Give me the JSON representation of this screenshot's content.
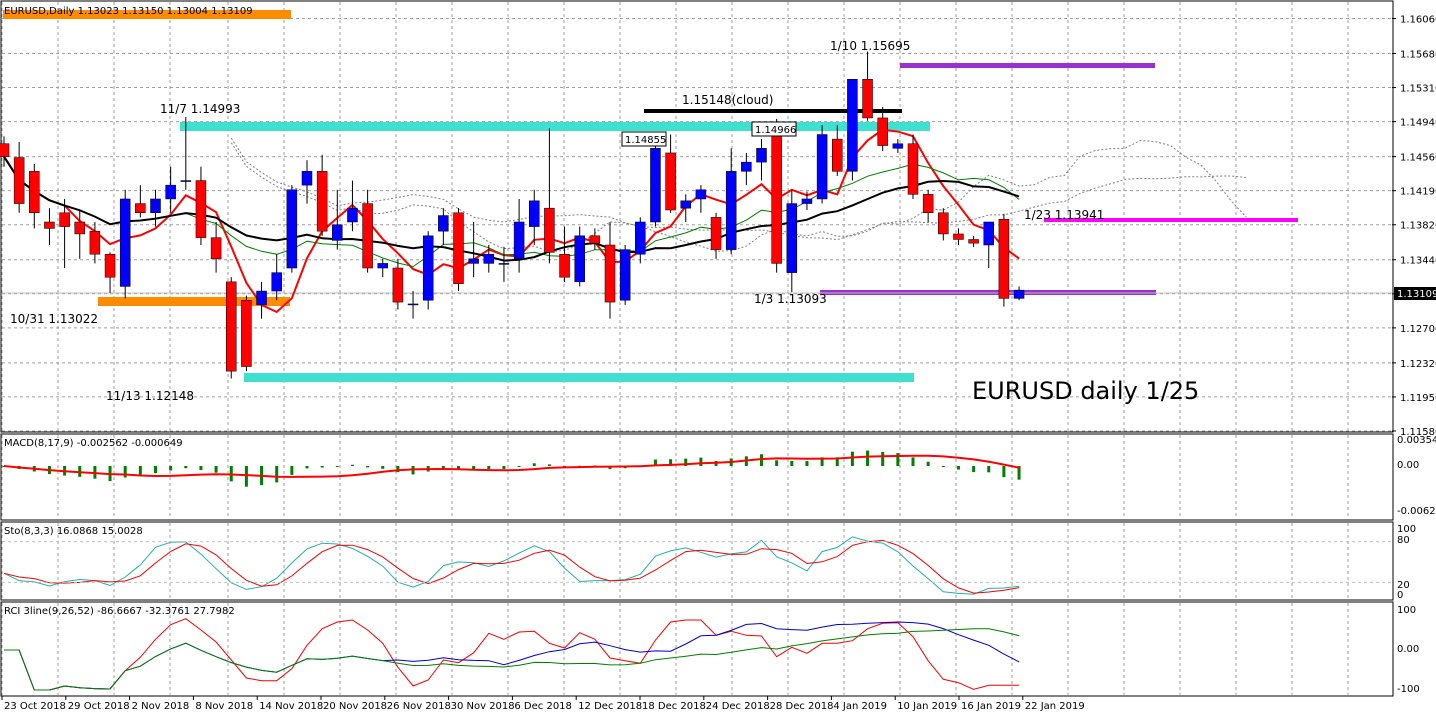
{
  "main": {
    "header": "EURUSD,Daily  1.13023 1.13150 1.13004 1.13109",
    "big_label": "EURUSD daily 1/25",
    "price_axis": [
      "1.16060",
      "1.15680",
      "1.15310",
      "1.14940",
      "1.14560",
      "1.14190",
      "1.13820",
      "1.13440",
      "1.13070",
      "1.12700",
      "1.12320",
      "1.11950",
      "1.11580"
    ],
    "current_price": "1.13109",
    "annotations": {
      "a1": "11/7 1.14993",
      "a2": "10/31 1.13022",
      "a3": "11/13 1.12148",
      "a4": "1.15148(cloud)",
      "a5": "1.14855",
      "a6": "1.14966",
      "a7": "1/10 1.15695",
      "a8": "1/3 1.13093",
      "a9": "1/23 1.13941"
    }
  },
  "macd": {
    "header": "MACD(8,17,9) -0.002562 -0.000649",
    "axis": [
      "0.003546",
      "0.00",
      "-0.006237"
    ]
  },
  "sto": {
    "header": "Sto(8,3,3) 16.0868 15.0028",
    "axis": [
      "100",
      "80",
      "20",
      "0"
    ]
  },
  "rci": {
    "header": "RCI 3line(9,26,52) -86.6667 -32.3761 27.7982",
    "axis": [
      "100",
      "0.00",
      "-100"
    ]
  },
  "date_axis": [
    "23 Oct 2018",
    "29 Oct 2018",
    "2 Nov 2018",
    "8 Nov 2018",
    "14 Nov 2018",
    "20 Nov 2018",
    "26 Nov 2018",
    "30 Nov 2018",
    "6 Dec 2018",
    "12 Dec 2018",
    "18 Dec 2018",
    "24 Dec 2018",
    "28 Dec 2018",
    "4 Jan 2019",
    "10 Jan 2019",
    "16 Jan 2019",
    "22 Jan 2019"
  ],
  "colors": {
    "bull": "#0000ff",
    "bear": "#ff0000",
    "orange": "#ff8c00",
    "cyan": "#40e0d0",
    "purple": "#9932cc",
    "magenta": "#ff00ff",
    "macd_hist": "#008000",
    "signal": "#ff0000",
    "ma_black": "#000000",
    "ma_green": "#008000",
    "ma_red": "#ff0000"
  },
  "chart_data": {
    "type": "candlestick",
    "symbol": "EURUSD",
    "timeframe": "Daily",
    "ylim": [
      1.1158,
      1.1625
    ],
    "candles": [
      [
        1.147,
        1.1478,
        1.1445,
        1.1456
      ],
      [
        1.1455,
        1.1472,
        1.1395,
        1.1405
      ],
      [
        1.144,
        1.1448,
        1.1378,
        1.1395
      ],
      [
        1.1385,
        1.14,
        1.136,
        1.1378
      ],
      [
        1.1395,
        1.141,
        1.1335,
        1.138
      ],
      [
        1.1385,
        1.1398,
        1.1345,
        1.1372
      ],
      [
        1.1375,
        1.1385,
        1.134,
        1.135
      ],
      [
        1.135,
        1.1352,
        1.1308,
        1.1325
      ],
      [
        1.1315,
        1.142,
        1.1302,
        1.141
      ],
      [
        1.1405,
        1.1425,
        1.139,
        1.1395
      ],
      [
        1.1395,
        1.142,
        1.138,
        1.141
      ],
      [
        1.141,
        1.1445,
        1.1395,
        1.1425
      ],
      [
        1.143,
        1.1499,
        1.142,
        1.143
      ],
      [
        1.143,
        1.1445,
        1.136,
        1.1368
      ],
      [
        1.1368,
        1.1385,
        1.133,
        1.1345
      ],
      [
        1.132,
        1.1325,
        1.1215,
        1.1223
      ],
      [
        1.13,
        1.1305,
        1.1223,
        1.1228
      ],
      [
        1.1295,
        1.132,
        1.128,
        1.131
      ],
      [
        1.131,
        1.135,
        1.13,
        1.133
      ],
      [
        1.1335,
        1.1425,
        1.133,
        1.142
      ],
      [
        1.1425,
        1.1452,
        1.1405,
        1.144
      ],
      [
        1.144,
        1.1458,
        1.137,
        1.1375
      ],
      [
        1.1365,
        1.142,
        1.1355,
        1.1382
      ],
      [
        1.1385,
        1.143,
        1.1375,
        1.14
      ],
      [
        1.1405,
        1.142,
        1.133,
        1.1335
      ],
      [
        1.1335,
        1.1345,
        1.1325,
        1.134
      ],
      [
        1.1335,
        1.1345,
        1.129,
        1.1298
      ],
      [
        1.1296,
        1.131,
        1.128,
        1.1296
      ],
      [
        1.13,
        1.1375,
        1.129,
        1.137
      ],
      [
        1.1375,
        1.14,
        1.136,
        1.1392
      ],
      [
        1.1395,
        1.14,
        1.131,
        1.1318
      ],
      [
        1.134,
        1.1385,
        1.1325,
        1.1345
      ],
      [
        1.134,
        1.136,
        1.133,
        1.135
      ],
      [
        1.134,
        1.1358,
        1.132,
        1.134
      ],
      [
        1.1345,
        1.141,
        1.133,
        1.1385
      ],
      [
        1.138,
        1.142,
        1.136,
        1.1408
      ],
      [
        1.14,
        1.1487,
        1.134,
        1.1352
      ],
      [
        1.135,
        1.138,
        1.132,
        1.1325
      ],
      [
        1.132,
        1.138,
        1.1315,
        1.137
      ],
      [
        1.137,
        1.1378,
        1.1355,
        1.1362
      ],
      [
        1.136,
        1.1385,
        1.128,
        1.1298
      ],
      [
        1.13,
        1.136,
        1.1295,
        1.1355
      ],
      [
        1.135,
        1.139,
        1.134,
        1.1385
      ],
      [
        1.1385,
        1.1468,
        1.138,
        1.1465
      ],
      [
        1.146,
        1.148,
        1.1395,
        1.1398
      ],
      [
        1.14,
        1.1415,
        1.1385,
        1.1408
      ],
      [
        1.141,
        1.1425,
        1.1395,
        1.142
      ],
      [
        1.139,
        1.1395,
        1.1345,
        1.1355
      ],
      [
        1.1355,
        1.1465,
        1.135,
        1.144
      ],
      [
        1.144,
        1.146,
        1.1425,
        1.145
      ],
      [
        1.145,
        1.1475,
        1.143,
        1.1465
      ],
      [
        1.148,
        1.1497,
        1.133,
        1.134
      ],
      [
        1.133,
        1.142,
        1.1309,
        1.1405
      ],
      [
        1.1405,
        1.1418,
        1.1398,
        1.141
      ],
      [
        1.141,
        1.149,
        1.1405,
        1.148
      ],
      [
        1.1475,
        1.149,
        1.1435,
        1.144
      ],
      [
        1.144,
        1.154,
        1.143,
        1.154
      ],
      [
        1.154,
        1.157,
        1.1495,
        1.1498
      ],
      [
        1.1498,
        1.151,
        1.1462,
        1.1468
      ],
      [
        1.1465,
        1.1475,
        1.146,
        1.147
      ],
      [
        1.147,
        1.148,
        1.141,
        1.1415
      ],
      [
        1.1415,
        1.142,
        1.1385,
        1.1395
      ],
      [
        1.1395,
        1.14,
        1.1365,
        1.1372
      ],
      [
        1.1372,
        1.1378,
        1.136,
        1.1366
      ],
      [
        1.1366,
        1.137,
        1.1358,
        1.1362
      ],
      [
        1.136,
        1.138,
        1.1335,
        1.1385
      ],
      [
        1.1388,
        1.1394,
        1.1293,
        1.1302
      ],
      [
        1.1302,
        1.1315,
        1.13,
        1.1311
      ]
    ]
  }
}
